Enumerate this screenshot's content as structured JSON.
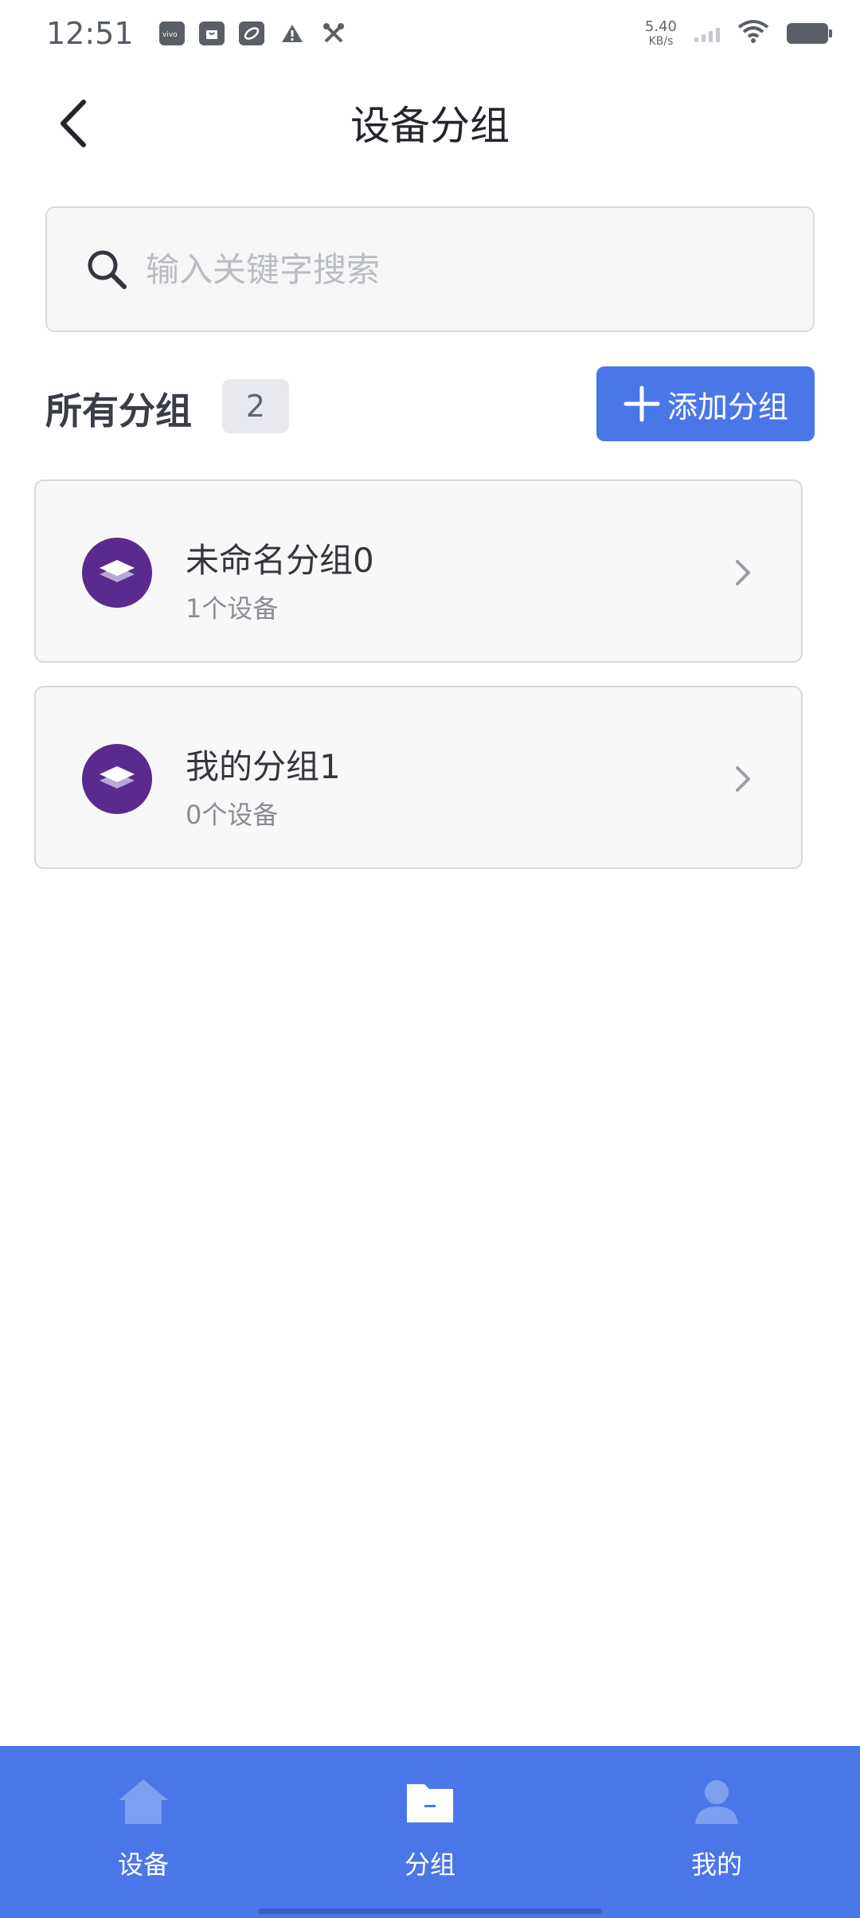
{
  "status_bar": {
    "time": "12:51",
    "net_speed_value": "5.40",
    "net_speed_unit": "KB/s",
    "notification_icons": [
      "vivo-icon",
      "bag-icon",
      "sync-icon",
      "warning-icon",
      "tools-icon"
    ],
    "system_icons": [
      "signal-icon",
      "wifi-icon",
      "battery-icon"
    ]
  },
  "header": {
    "title": "设备分组",
    "back_icon": "chevron-left-icon"
  },
  "search": {
    "placeholder": "输入关键字搜索",
    "value": "",
    "icon": "search-icon"
  },
  "groups_section": {
    "title": "所有分组",
    "count": "2",
    "add_button_label": "添加分组",
    "add_icon": "plus-icon"
  },
  "groups": [
    {
      "name": "未命名分组0",
      "device_count": "1个设备",
      "icon": "layers-icon"
    },
    {
      "name": "我的分组1",
      "device_count": "0个设备",
      "icon": "layers-icon"
    }
  ],
  "bottom_nav": {
    "items": [
      {
        "label": "设备",
        "icon": "home-icon",
        "active": false
      },
      {
        "label": "分组",
        "icon": "folder-icon",
        "active": true
      },
      {
        "label": "我的",
        "icon": "user-icon",
        "active": false
      }
    ]
  },
  "colors": {
    "primary": "#4a77e8",
    "avatar": "#5a2a8f",
    "nav_inactive_icon": "#7fa0f0"
  }
}
